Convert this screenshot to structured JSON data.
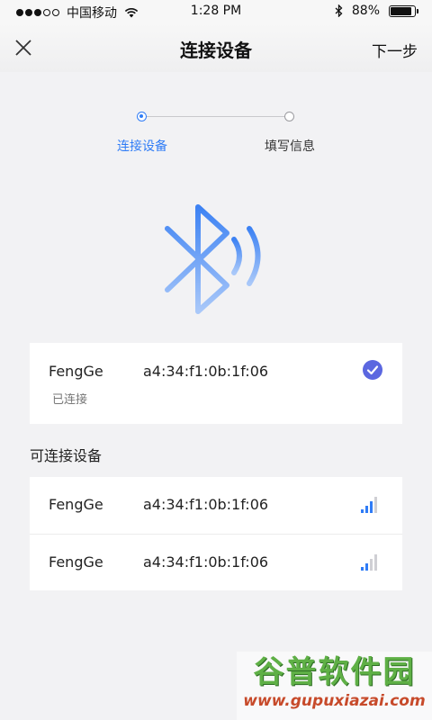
{
  "status_bar": {
    "carrier": "中国移动",
    "time": "1:28 PM",
    "battery_percent": "88%",
    "battery_level": 0.88,
    "icons": [
      "wifi-icon",
      "bluetooth-icon",
      "battery-icon"
    ]
  },
  "nav": {
    "title": "连接设备",
    "next_label": "下一步",
    "close_icon": "close-icon"
  },
  "stepper": {
    "steps": [
      {
        "label": "连接设备",
        "active": true
      },
      {
        "label": "填写信息",
        "active": false
      }
    ]
  },
  "connected_device": {
    "name": "FengGe",
    "mac": "a4:34:f1:0b:1f:06",
    "status": "已连接"
  },
  "available": {
    "title": "可连接设备",
    "devices": [
      {
        "name": "FengGe",
        "mac": "a4:34:f1:0b:1f:06",
        "signal_bars": 3
      },
      {
        "name": "FengGe",
        "mac": "a4:34:f1:0b:1f:06",
        "signal_bars": 2
      }
    ]
  },
  "watermark": {
    "title": "谷普软件园",
    "url": "www.gupuxiazai.com"
  },
  "colors": {
    "accent": "#2f7cf6",
    "check": "#5b67e0",
    "signal_active": "#2f7cf6",
    "signal_inactive": "#cfcfd4"
  }
}
